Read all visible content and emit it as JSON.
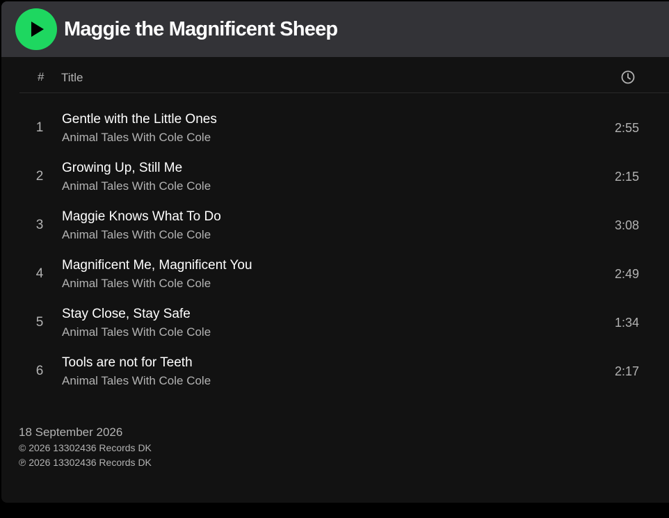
{
  "album": {
    "title": "Maggie the Magnificent Sheep"
  },
  "colors": {
    "accent": "#1ed760",
    "background": "#121212",
    "header_bg": "#333337",
    "text_primary": "#ffffff",
    "text_secondary": "#b3b3b3"
  },
  "icons": {
    "play": "play-icon",
    "duration": "clock-icon"
  },
  "tracklist_header": {
    "number": "#",
    "title": "Title"
  },
  "tracks": [
    {
      "number": "1",
      "title": "Gentle with the Little Ones",
      "artist": "Animal Tales With Cole Cole",
      "duration": "2:55"
    },
    {
      "number": "2",
      "title": "Growing Up, Still Me",
      "artist": "Animal Tales With Cole Cole",
      "duration": "2:15"
    },
    {
      "number": "3",
      "title": "Maggie Knows What To Do",
      "artist": "Animal Tales With Cole Cole",
      "duration": "3:08"
    },
    {
      "number": "4",
      "title": "Magnificent Me, Magnificent You",
      "artist": "Animal Tales With Cole Cole",
      "duration": "2:49"
    },
    {
      "number": "5",
      "title": "Stay Close, Stay Safe",
      "artist": "Animal Tales With Cole Cole",
      "duration": "1:34"
    },
    {
      "number": "6",
      "title": "Tools are not for Teeth",
      "artist": "Animal Tales With Cole Cole",
      "duration": "2:17"
    }
  ],
  "footer": {
    "release_date": "18 September 2026",
    "copyright": "© 2026 13302436 Records DK",
    "phonographic": "℗ 2026 13302436 Records DK"
  }
}
